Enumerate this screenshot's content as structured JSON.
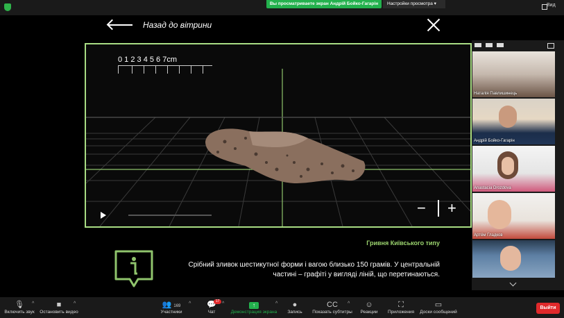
{
  "topbar": {
    "share_banner": "Вы просматриваете экран Андрій Бойко-Гагарін",
    "view_settings": "Настройки просмотра",
    "view_label": "Вид"
  },
  "museum": {
    "back_label": "Назад до вітрини",
    "ruler_label": "0 1 2 3 4 5 6 7cm",
    "zoom_out": "−",
    "zoom_in": "+",
    "caption_title": "Гривня Київського типу",
    "caption_text": "Срібний зливок шестикутної форми і вагою близько 150 грамів. У центральній частині – графіті у вигляді ліній, що перетинаються."
  },
  "participants": [
    {
      "name": "Наталія Павлишинець"
    },
    {
      "name": "Андрій Бойко-Гагарін"
    },
    {
      "name": "Anastacia Drozdova"
    },
    {
      "name": "Артём Гладков"
    },
    {
      "name": ""
    }
  ],
  "toolbar": {
    "unmute": "Включить звук",
    "stop_video": "Остановить видео",
    "participants": "Участники",
    "participants_count": "169",
    "chat": "Чат",
    "chat_badge": "17",
    "share": "Демонстрация экрана",
    "record": "Запись",
    "subtitles": "Показать субтитры",
    "reactions": "Реакции",
    "apps": "Приложения",
    "whiteboard": "Доски сообщений",
    "leave": "Выйти"
  },
  "colors": {
    "accent_green": "#a9dd84",
    "zoom_green": "#23b14d",
    "leave_red": "#e0292b"
  }
}
